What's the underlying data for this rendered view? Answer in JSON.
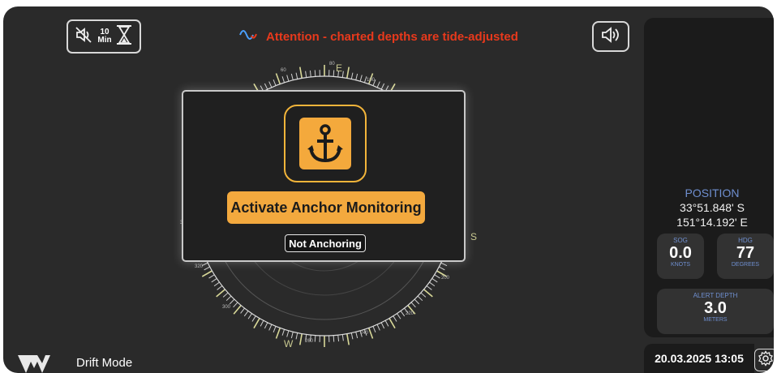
{
  "toolbar": {
    "mute_minutes": "10",
    "mute_unit": "Min",
    "mute_icon": "speaker-muted-icon",
    "timer_icon": "hourglass-icon",
    "volume_icon": "speaker-icon"
  },
  "alert": {
    "icon": "tide-wave-icon",
    "text": "Attention - charted depths are tide-adjusted",
    "color": "#e8391c"
  },
  "compass": {
    "cardinals": [
      "N",
      "E",
      "S",
      "W"
    ],
    "degree_labels": [
      "80",
      "100",
      "340",
      "60",
      "200",
      "220",
      "240",
      "260",
      "300",
      "320"
    ]
  },
  "modal": {
    "icon": "anchor-icon",
    "activate_label": "Activate Anchor Monitoring",
    "status": "Not Anchoring",
    "accent": "#f3a93e"
  },
  "position": {
    "title": "POSITION",
    "lat": "33°51.848' S",
    "lon": "151°14.192' E"
  },
  "sog": {
    "label": "SOG",
    "value": "0.0",
    "unit": "KNOTS"
  },
  "hdg": {
    "label": "HDG",
    "value": "77",
    "unit": "DEGREES"
  },
  "alert_depth": {
    "label": "ALERT DEPTH",
    "value": "3.0",
    "unit": "METERS"
  },
  "footer": {
    "mode": "Drift Mode",
    "datetime": "20.03.2025 13:05",
    "settings_icon": "gear-icon",
    "logo": "brand-logo"
  }
}
